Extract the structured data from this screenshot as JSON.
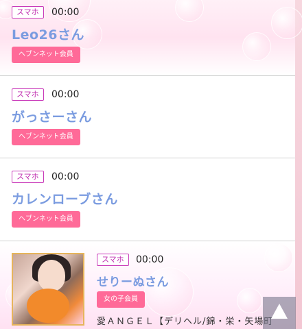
{
  "entries": [
    {
      "tag": "スマホ",
      "time": "00:00",
      "name": "Leo26さん",
      "badge": "ヘブンネット会員"
    },
    {
      "tag": "スマホ",
      "time": "00:00",
      "name": "がっさーさん",
      "badge": "ヘブンネット会員"
    },
    {
      "tag": "スマホ",
      "time": "00:00",
      "name": "カレンローブさん",
      "badge": "ヘブンネット会員"
    },
    {
      "tag": "スマホ",
      "time": "00:00",
      "name": "せりーぬさん",
      "badge": "女の子会員",
      "shop": "愛ＡＮＧＥＬ【デリヘル/錦・栄・矢場町"
    }
  ],
  "icons": {
    "scroll_top": "arrow-up-icon"
  },
  "colors": {
    "accent": "#ff6a98",
    "name": "#7b9ce0",
    "tag": "#c93ab9"
  }
}
